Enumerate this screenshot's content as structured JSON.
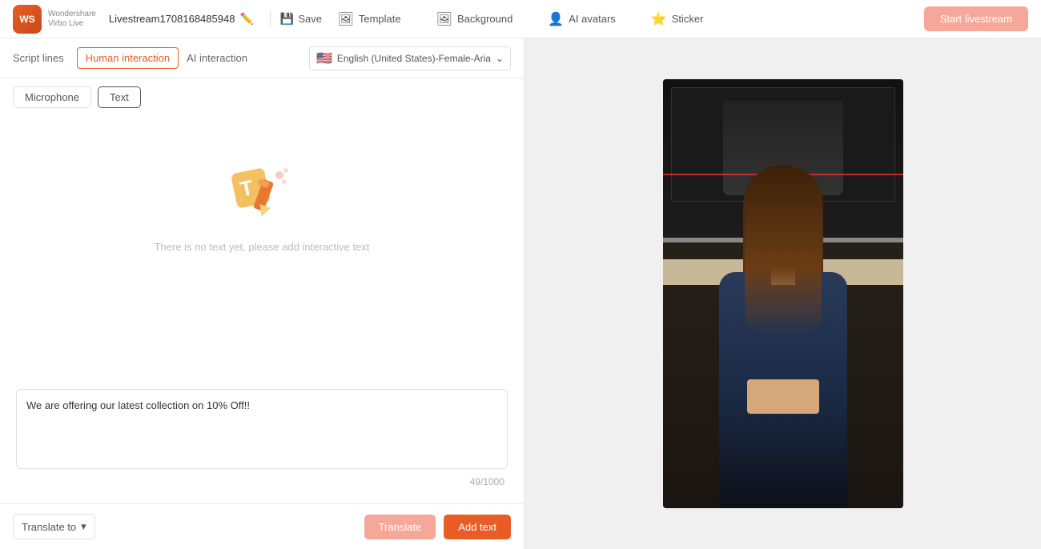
{
  "header": {
    "logo_line1": "Wondershare",
    "logo_line2": "Virbo Live",
    "project_name": "Livestream1708168485948",
    "save_label": "Save",
    "nav_items": [
      {
        "id": "template",
        "label": "Template",
        "icon": "🖼"
      },
      {
        "id": "background",
        "label": "Background",
        "icon": "🖼"
      },
      {
        "id": "ai_avatars",
        "label": "AI avatars",
        "icon": "👤"
      },
      {
        "id": "sticker",
        "label": "Sticker",
        "icon": "⭐"
      }
    ],
    "start_label": "Start livestream"
  },
  "left": {
    "script_lines_label": "Script lines",
    "tabs": [
      {
        "id": "human",
        "label": "Human interaction",
        "active": true
      },
      {
        "id": "ai",
        "label": "AI interaction",
        "active": false
      }
    ],
    "language": "English (United States)-Female-Aria",
    "sub_tabs": [
      {
        "id": "mic",
        "label": "Microphone",
        "active": false
      },
      {
        "id": "text",
        "label": "Text",
        "active": true
      }
    ],
    "empty_text": "There is no text yet, please add interactive text",
    "text_content": "We are offering our latest collection on 10% Off!!",
    "char_count": "49/1000",
    "translate_label": "Translate to",
    "translate_btn": "Translate",
    "add_text_btn": "Add text"
  }
}
